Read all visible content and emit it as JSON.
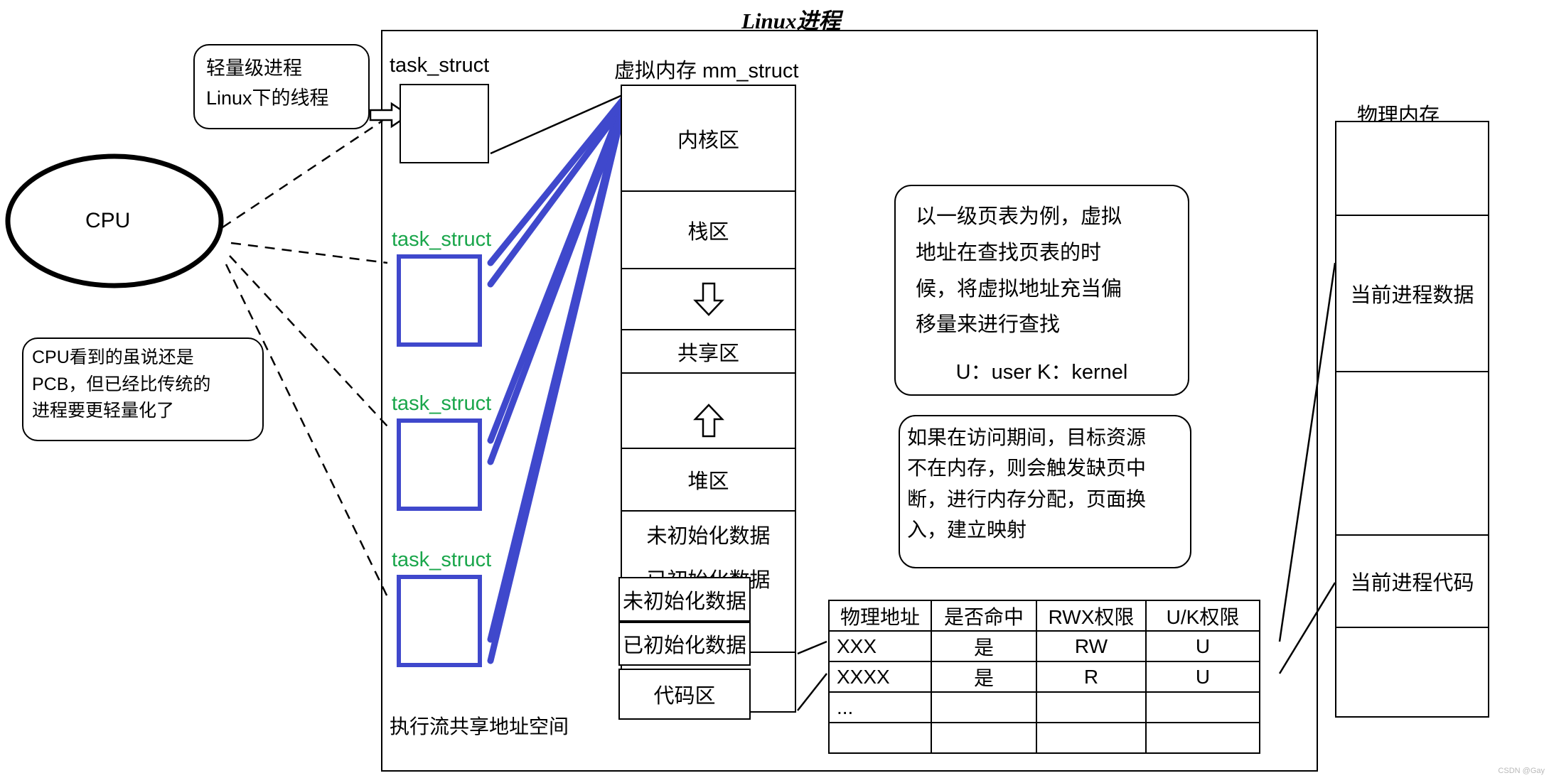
{
  "title": "Linux进程",
  "labels": {
    "task_struct_top": "task_struct",
    "mm_struct": "虚拟内存 mm_struct",
    "physical_memory": "物理内存",
    "shared_address_space": "执行流共享地址空间"
  },
  "cpu": {
    "label": "CPU"
  },
  "callouts": [
    {
      "name": "lightweight-process",
      "line1": "轻量级进程",
      "line2": "Linux下的线程"
    },
    {
      "name": "cpu-sees-pcb",
      "line1": "CPU看到的虽说还是",
      "line2": "PCB，但已经比传统的",
      "line3": "进程要更轻量化了"
    }
  ],
  "task_structs": [
    {
      "label": "task_struct",
      "color": "#1aa64b"
    },
    {
      "label": "task_struct",
      "color": "#1aa64b"
    },
    {
      "label": "task_struct",
      "color": "#1aa64b"
    }
  ],
  "mm_struct": {
    "regions": [
      {
        "name": "kernel",
        "label": "内核区"
      },
      {
        "name": "stack",
        "label": "栈区"
      },
      {
        "name": "stack-grow-down",
        "label": "",
        "icon": "arrow-down-icon"
      },
      {
        "name": "shared",
        "label": "共享区"
      },
      {
        "name": "heap-grow-up",
        "label": "",
        "icon": "arrow-up-icon"
      },
      {
        "name": "heap",
        "label": "堆区"
      },
      {
        "name": "uninitialized-data",
        "label": "未初始化数据"
      },
      {
        "name": "initialized-data",
        "label": "已初始化数据"
      },
      {
        "name": "code",
        "label": "代码区"
      },
      {
        "name": "reserved",
        "label": ""
      }
    ]
  },
  "notes": [
    {
      "name": "page-table-note",
      "lines": [
        "以一级页表为例，虚拟",
        "地址在查找页表的时",
        "候，将虚拟地址充当偏",
        "移量来进行查找"
      ],
      "legend": "U：user  K：kernel"
    },
    {
      "name": "page-fault-note",
      "lines": [
        "如果在访问期间，目标资源",
        "不在内存，则会触发缺页中",
        "断，进行内存分配，页面换",
        "入，建立映射"
      ]
    }
  ],
  "page_table": {
    "headers": [
      "物理地址",
      "是否命中",
      "RWX权限",
      "U/K权限"
    ],
    "rows": [
      [
        "XXX",
        "是",
        "RW",
        "U"
      ],
      [
        "XXXX",
        "是",
        "R",
        "U"
      ],
      [
        "...",
        "",
        "",
        ""
      ],
      [
        "",
        "",
        "",
        ""
      ]
    ]
  },
  "physical_memory": {
    "cells": [
      {
        "name": "empty-top",
        "label": ""
      },
      {
        "name": "current-process-data",
        "label": "当前进程数据"
      },
      {
        "name": "middle-gap",
        "label": ""
      },
      {
        "name": "current-process-code",
        "label": "当前进程代码"
      },
      {
        "name": "empty-bottom",
        "label": ""
      }
    ]
  },
  "watermark": "CSDN @Gay",
  "colors": {
    "task_struct_label": "#1aa64b",
    "task_struct_border": "#3f48cc",
    "link_blue": "#3f48cc",
    "outline": "#000000"
  }
}
